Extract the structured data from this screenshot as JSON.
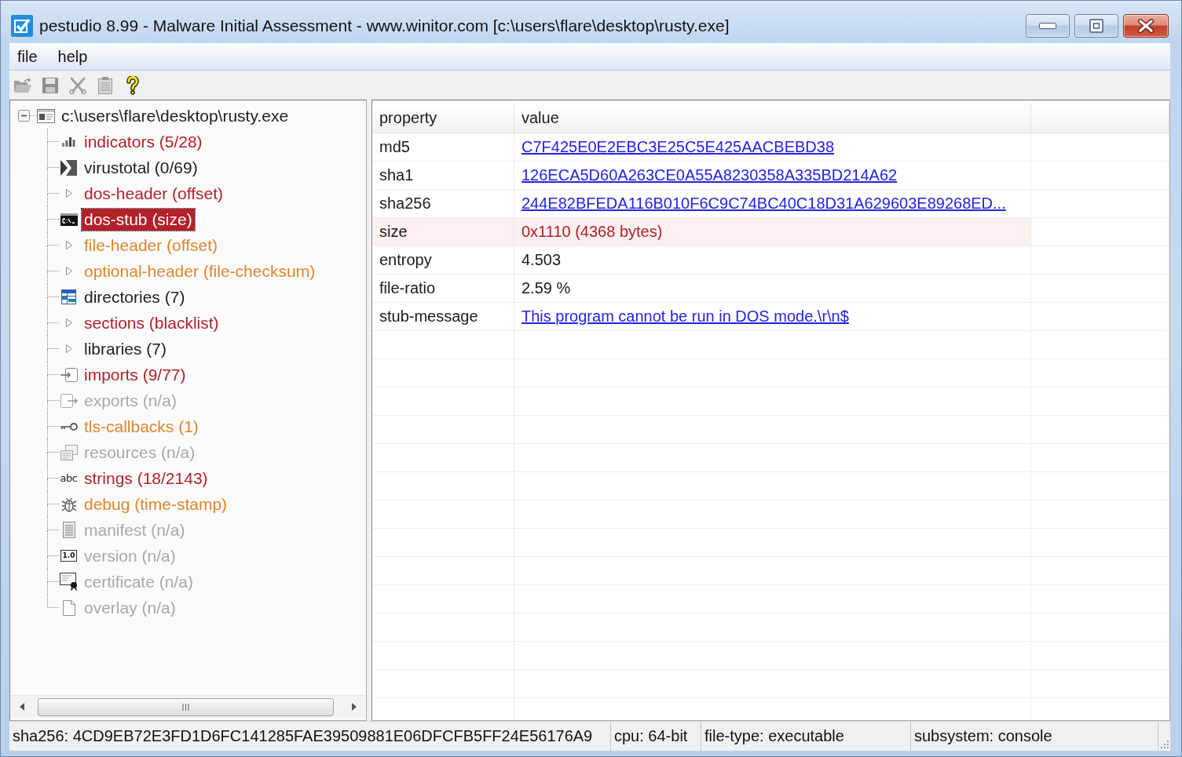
{
  "window": {
    "title": "pestudio 8.99 - Malware Initial Assessment - www.winitor.com [c:\\users\\flare\\desktop\\rusty.exe]"
  },
  "menu": [
    "file",
    "help"
  ],
  "toolbar": [
    {
      "kind": "open",
      "disabled": true
    },
    {
      "kind": "save",
      "disabled": true
    },
    {
      "kind": "cut",
      "disabled": true
    },
    {
      "kind": "clipboard",
      "disabled": true
    },
    {
      "kind": "help",
      "disabled": false
    }
  ],
  "tree": {
    "label": "c:\\users\\flare\\desktop\\rusty.exe",
    "expanded": true,
    "selected": false,
    "children": [
      {
        "label": "indicators (5/28)",
        "kind": "bars",
        "color": "#b3202a",
        "selected": false
      },
      {
        "label": "virustotal (0/69)",
        "kind": "virustotal",
        "color": "#1e1e1e",
        "selected": false
      },
      {
        "label": "dos-header (offset)",
        "expanded": false,
        "color": "#b3202a",
        "selected": false
      },
      {
        "label": "dos-stub (size)",
        "kind": "console",
        "color": "#b3202a",
        "selected": true
      },
      {
        "label": "file-header (offset)",
        "expanded": false,
        "color": "#e0852c",
        "selected": false
      },
      {
        "label": "optional-header (file-checksum)",
        "expanded": false,
        "color": "#e0852c",
        "selected": false
      },
      {
        "label": "directories (7)",
        "kind": "grid",
        "color": "#1e1e1e",
        "selected": false
      },
      {
        "label": "sections (blacklist)",
        "expanded": false,
        "color": "#b3202a",
        "selected": false
      },
      {
        "label": "libraries (7)",
        "expanded": false,
        "color": "#1e1e1e",
        "selected": false
      },
      {
        "label": "imports (9/77)",
        "kind": "import",
        "color": "#b3202a",
        "selected": false
      },
      {
        "label": "exports (n/a)",
        "kind": "export",
        "color": "#a8a8a8",
        "selected": false
      },
      {
        "label": "tls-callbacks (1)",
        "kind": "key",
        "color": "#e0852c",
        "selected": false
      },
      {
        "label": "resources (n/a)",
        "kind": "resources",
        "color": "#a8a8a8",
        "selected": false
      },
      {
        "label": "strings (18/2143)",
        "kind": "text",
        "icon_text": "abc",
        "color": "#b3202a",
        "selected": false
      },
      {
        "label": "debug (time-stamp)",
        "kind": "bug",
        "color": "#e0852c",
        "selected": false
      },
      {
        "label": "manifest (n/a)",
        "kind": "manifest",
        "color": "#a8a8a8",
        "selected": false
      },
      {
        "label": "version (n/a)",
        "kind": "version",
        "icon_text": "1.0",
        "color": "#a8a8a8",
        "selected": false
      },
      {
        "label": "certificate (n/a)",
        "kind": "certificate",
        "color": "#a8a8a8",
        "selected": false
      },
      {
        "label": "overlay (n/a)",
        "kind": "page",
        "color": "#a8a8a8",
        "selected": false
      }
    ]
  },
  "table": {
    "columns": [
      "property",
      "value"
    ],
    "rows": [
      {
        "property": "md5",
        "value": "C7F425E0E2EBC3E25C5E425AACBEBD38",
        "kind": "link"
      },
      {
        "property": "sha1",
        "value": "126ECA5D60A263CE0A55A8230358A335BD214A62",
        "kind": "link"
      },
      {
        "property": "sha256",
        "value": "244E82BFEDA116B010F6C9C74BC40C18D31A629603E89268ED...",
        "kind": "link"
      },
      {
        "property": "size",
        "value": "0x1110 (4368 bytes)",
        "kind": "flagged"
      },
      {
        "property": "entropy",
        "value": "4.503",
        "kind": "plain"
      },
      {
        "property": "file-ratio",
        "value": "2.59 %",
        "kind": "plain"
      },
      {
        "property": "stub-message",
        "value": "This program cannot be run in DOS mode.\\r\\n$",
        "kind": "link"
      }
    ]
  },
  "status_bar": [
    "sha256: 4CD9EB72E3FD1D6FC141285FAE39509881E06DFCFB5FF24E56176A9",
    "cpu: 64-bit",
    "file-type: executable",
    "subsystem: console"
  ]
}
